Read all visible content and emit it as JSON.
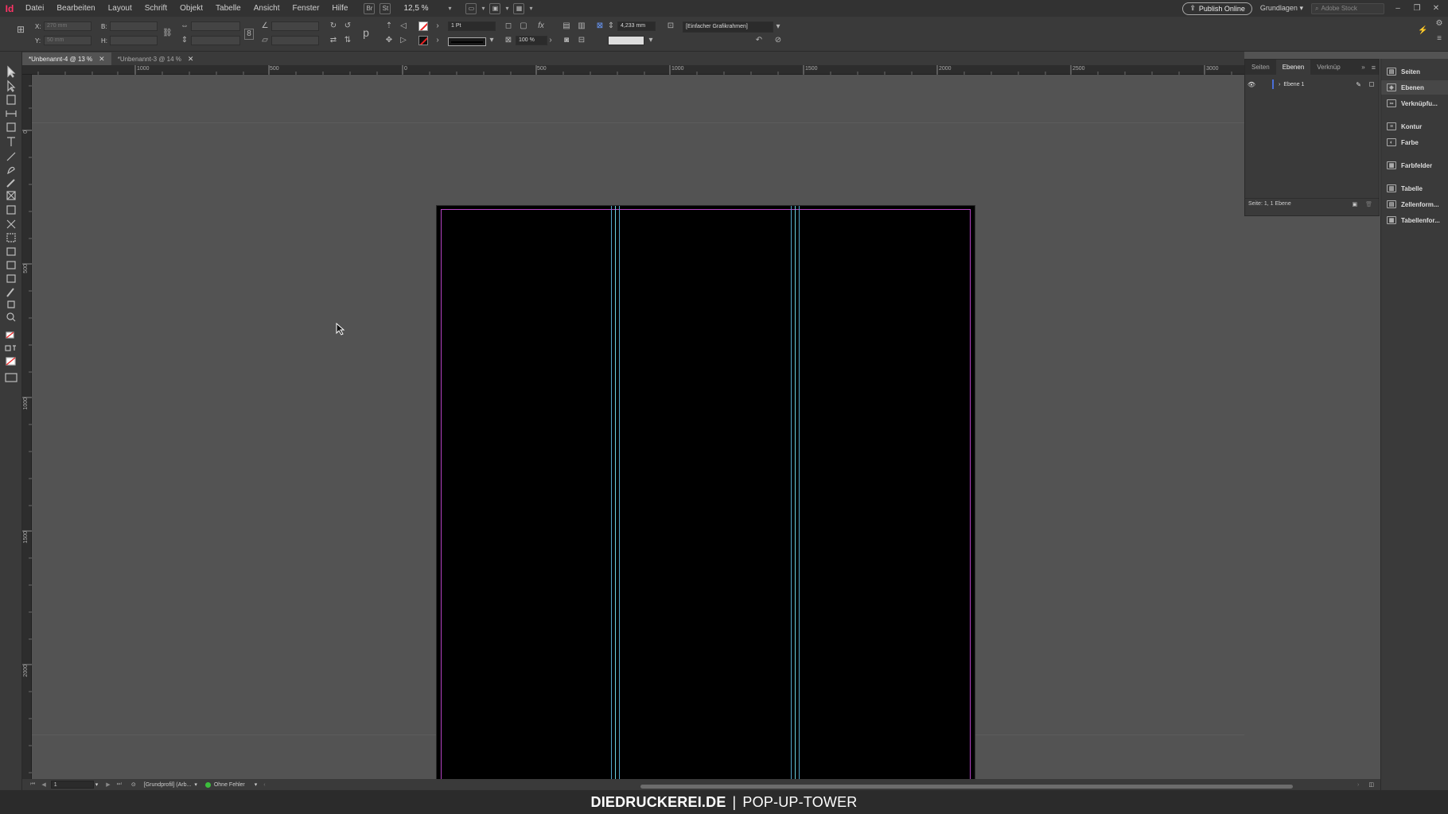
{
  "app": {
    "logo": "Id"
  },
  "menu": [
    "Datei",
    "Bearbeiten",
    "Layout",
    "Schrift",
    "Objekt",
    "Tabelle",
    "Ansicht",
    "Fenster",
    "Hilfe"
  ],
  "menubar_tools": {
    "br": "Br",
    "st": "St",
    "zoom": "12,5 %"
  },
  "menubar_right": {
    "publish": "Publish Online",
    "workspace": "Grundlagen",
    "search_placeholder": "Adobe Stock"
  },
  "control": {
    "x_label": "X:",
    "y_label": "Y:",
    "w_label": "B:",
    "h_label": "H:",
    "x_value": "270 mm",
    "y_value": "50 mm",
    "stroke_weight": "1 Pt",
    "scale": "100 %",
    "offset": "4,233 mm",
    "object_style": "[Einfacher Grafikrahmen]"
  },
  "tabs": [
    {
      "label": "*Unbenannt-4 @ 13 %",
      "active": true
    },
    {
      "label": "*Unbenannt-3 @ 14 %",
      "active": false
    }
  ],
  "ruler_h": [
    "1000",
    "500",
    "0",
    "500",
    "1000",
    "1500",
    "2000",
    "2500",
    "3000"
  ],
  "ruler_v": [
    "0",
    "500",
    "1000",
    "1500",
    "2000"
  ],
  "layers_panel": {
    "tabs": [
      "Seiten",
      "Ebenen",
      "Verknüp"
    ],
    "active_tab": "Ebenen",
    "layers": [
      {
        "name": "Ebene 1",
        "color": "#4a6fd8"
      }
    ],
    "footer": "Seite: 1, 1 Ebene"
  },
  "dock": [
    {
      "label": "Seiten",
      "icon": "pages-icon"
    },
    {
      "label": "Ebenen",
      "icon": "layers-icon",
      "active": true
    },
    {
      "label": "Verknüpfu...",
      "icon": "links-icon"
    },
    {
      "label": "Kontur",
      "icon": "stroke-icon"
    },
    {
      "label": "Farbe",
      "icon": "color-icon"
    },
    {
      "label": "Farbfelder",
      "icon": "swatches-icon"
    },
    {
      "label": "Tabelle",
      "icon": "table-icon"
    },
    {
      "label": "Zellenform...",
      "icon": "cell-styles-icon"
    },
    {
      "label": "Tabellenfor...",
      "icon": "table-styles-icon"
    }
  ],
  "status": {
    "page": "1",
    "profile": "[Grundprofil] (Arb...",
    "preflight": "Ohne Fehler"
  },
  "watermark": {
    "brand": "DIEDRUCKEREI.DE",
    "sep": "|",
    "title": "POP-UP-TOWER"
  },
  "colors": {
    "margin": "#b443c4",
    "guide": "#53a6c8",
    "layer": "#4a6fd8",
    "preflight_ok": "#3cbe3c"
  }
}
